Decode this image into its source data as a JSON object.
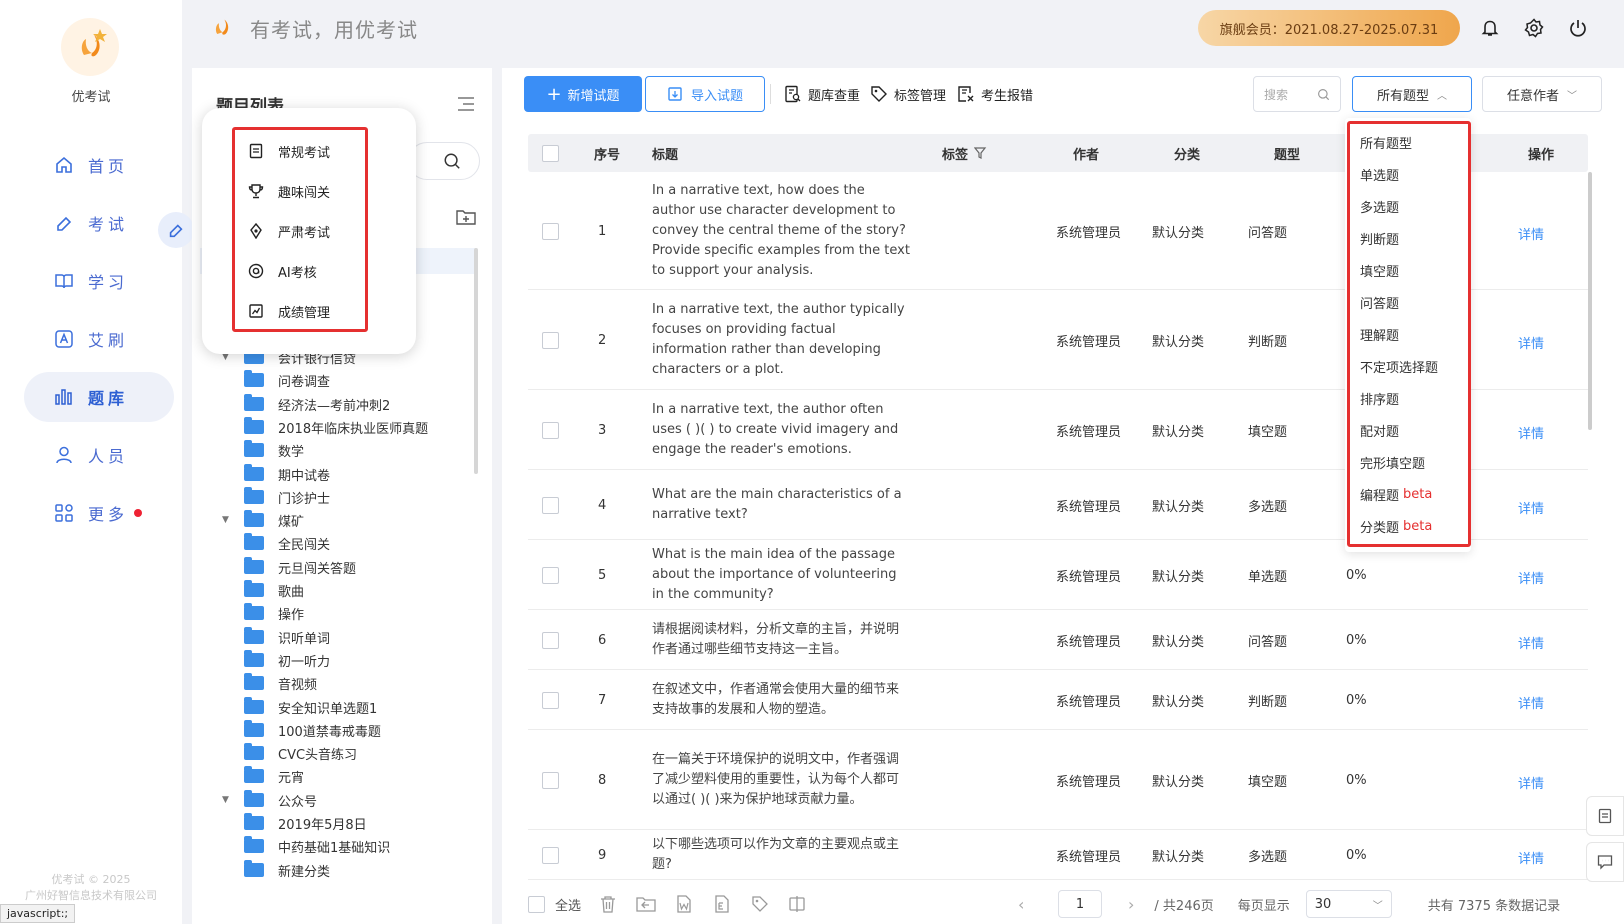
{
  "app": {
    "name": "优考试",
    "slogan": "有考试，用优考试",
    "vip_label": "旗舰会员：2021.08.27-2025.07.31"
  },
  "nav": {
    "items": [
      {
        "label": "首页",
        "icon": "home-icon"
      },
      {
        "label": "考试",
        "icon": "exam-icon"
      },
      {
        "label": "学习",
        "icon": "book-icon"
      },
      {
        "label": "艾刷",
        "icon": "a-icon"
      },
      {
        "label": "题库",
        "icon": "chart-bars-icon"
      },
      {
        "label": "人员",
        "icon": "user-icon"
      },
      {
        "label": "更多",
        "icon": "grid-icon"
      }
    ],
    "copyright": "优考试 © 2025",
    "company": "广州好智信息技术有限公司",
    "status_link": "javascript:;"
  },
  "tree": {
    "title": "题目列表",
    "items": [
      {
        "label": "会计银行信贷",
        "caret": "▼"
      },
      {
        "label": "问卷调查",
        "caret": ""
      },
      {
        "label": "经济法—考前冲刺2",
        "caret": ""
      },
      {
        "label": "2018年临床执业医师真题",
        "caret": ""
      },
      {
        "label": "数学",
        "caret": ""
      },
      {
        "label": "期中试卷",
        "caret": ""
      },
      {
        "label": "门诊护士",
        "caret": ""
      },
      {
        "label": "煤矿",
        "caret": "▼"
      },
      {
        "label": "全民闯关",
        "caret": ""
      },
      {
        "label": "元旦闯关答题",
        "caret": ""
      },
      {
        "label": "歌曲",
        "caret": ""
      },
      {
        "label": "操作",
        "caret": ""
      },
      {
        "label": "识听单词",
        "caret": ""
      },
      {
        "label": "初一听力",
        "caret": ""
      },
      {
        "label": "音视频",
        "caret": ""
      },
      {
        "label": "安全知识单选题1",
        "caret": ""
      },
      {
        "label": "100道禁毒戒毒题",
        "caret": ""
      },
      {
        "label": "CVC头音练习",
        "caret": ""
      },
      {
        "label": "元宵",
        "caret": ""
      },
      {
        "label": "公众号",
        "caret": "▼"
      },
      {
        "label": "2019年5月8日",
        "caret": ""
      },
      {
        "label": "中药基础1基础知识",
        "caret": ""
      },
      {
        "label": "新建分类",
        "caret": ""
      }
    ]
  },
  "exam_menu": {
    "items": [
      "常规考试",
      "趣味闯关",
      "严肃考试",
      "AI考核",
      "成绩管理"
    ]
  },
  "toolbar": {
    "add": "新增试题",
    "import": "导入试题",
    "dup": "题库查重",
    "tags": "标签管理",
    "report": "考生报错",
    "search_placeholder": "搜索",
    "type_select": "所有题型",
    "author_select": "任意作者"
  },
  "table": {
    "headers": {
      "index": "序号",
      "title": "标题",
      "tag": "标签",
      "author": "作者",
      "category": "分类",
      "type": "题型",
      "action": "操作"
    },
    "rows": [
      {
        "index": "1",
        "title": "In a narrative text, how does the author use character development to convey the central theme of the story? Provide specific examples from the text to support your analysis.",
        "author": "系统管理员",
        "category": "默认分类",
        "type": "问答题",
        "rate": "",
        "action": "详情"
      },
      {
        "index": "2",
        "title": "In a narrative text, the author typically focuses on providing factual information rather than developing characters or a plot.",
        "author": "系统管理员",
        "category": "默认分类",
        "type": "判断题",
        "rate": "",
        "action": "详情"
      },
      {
        "index": "3",
        "title": "In a narrative text, the author often uses (    )(    ) to create vivid imagery and engage the reader's emotions.",
        "author": "系统管理员",
        "category": "默认分类",
        "type": "填空题",
        "rate": "",
        "action": "详情"
      },
      {
        "index": "4",
        "title": "What are the main characteristics of a narrative text?",
        "author": "系统管理员",
        "category": "默认分类",
        "type": "多选题",
        "rate": "",
        "action": "详情"
      },
      {
        "index": "5",
        "title": "What is the main idea of the passage about the importance of volunteering in the community?",
        "author": "系统管理员",
        "category": "默认分类",
        "type": "单选题",
        "rate": "0%",
        "action": "详情"
      },
      {
        "index": "6",
        "title": "请根据阅读材料，分析文章的主旨，并说明作者通过哪些细节支持这一主旨。",
        "author": "系统管理员",
        "category": "默认分类",
        "type": "问答题",
        "rate": "0%",
        "action": "详情"
      },
      {
        "index": "7",
        "title": "在叙述文中，作者通常会使用大量的细节来支持故事的发展和人物的塑造。",
        "author": "系统管理员",
        "category": "默认分类",
        "type": "判断题",
        "rate": "0%",
        "action": "详情"
      },
      {
        "index": "8",
        "title": "在一篇关于环境保护的说明文中，作者强调了减少塑料使用的重要性，认为每个人都可以通过(    )(    )来为保护地球贡献力量。",
        "author": "系统管理员",
        "category": "默认分类",
        "type": "填空题",
        "rate": "0%",
        "action": "详情"
      },
      {
        "index": "9",
        "title": "以下哪些选项可以作为文章的主要观点或主题?",
        "author": "系统管理员",
        "category": "默认分类",
        "type": "多选题",
        "rate": "0%",
        "action": "详情"
      }
    ]
  },
  "type_dropdown": {
    "items": [
      {
        "label": "所有题型",
        "beta": ""
      },
      {
        "label": "单选题",
        "beta": ""
      },
      {
        "label": "多选题",
        "beta": ""
      },
      {
        "label": "判断题",
        "beta": ""
      },
      {
        "label": "填空题",
        "beta": ""
      },
      {
        "label": "问答题",
        "beta": ""
      },
      {
        "label": "理解题",
        "beta": ""
      },
      {
        "label": "不定项选择题",
        "beta": ""
      },
      {
        "label": "排序题",
        "beta": ""
      },
      {
        "label": "配对题",
        "beta": ""
      },
      {
        "label": "完形填空题",
        "beta": ""
      },
      {
        "label": "编程题",
        "beta": "beta"
      },
      {
        "label": "分类题",
        "beta": "beta"
      }
    ]
  },
  "footer": {
    "select_all": "全选",
    "page": "1",
    "total_pages": "/ 共246页",
    "per_page_label": "每页显示",
    "per_page": "30",
    "total": "共有 7375 条数据记录"
  },
  "colors": {
    "primary": "#3a8ef6",
    "highlight": "#e53030",
    "nav_active": "#2d5fd3",
    "vip_gold": "#efa64c"
  }
}
